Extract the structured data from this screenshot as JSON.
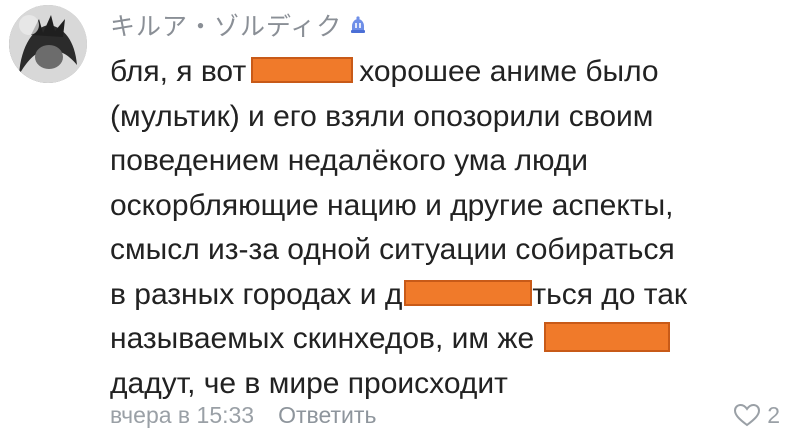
{
  "comment": {
    "author": "キルア・ゾルディク",
    "badge_icon": "donut-badge-icon",
    "lines": {
      "l1_a": "бля, я вот",
      "l1_b": "хорошее аниме было",
      "l2": "(мультик) и его взяли опозорили своим",
      "l3": "поведением недалёкого ума люди",
      "l4": "оскорбляющие нацию и другие аспекты,",
      "l5": "смысл из-за одной ситуации собираться",
      "l6_a": "в разных городах и д",
      "l6_b": "ться до так",
      "l7_a": "называемых скинхедов, им же",
      "l8": "дадут, че в мире происходит"
    },
    "redaction_color": "#f07a2a",
    "timestamp": "вчера в 15:33",
    "reply_label": "Ответить",
    "like_icon": "heart-icon",
    "like_count": "2"
  }
}
